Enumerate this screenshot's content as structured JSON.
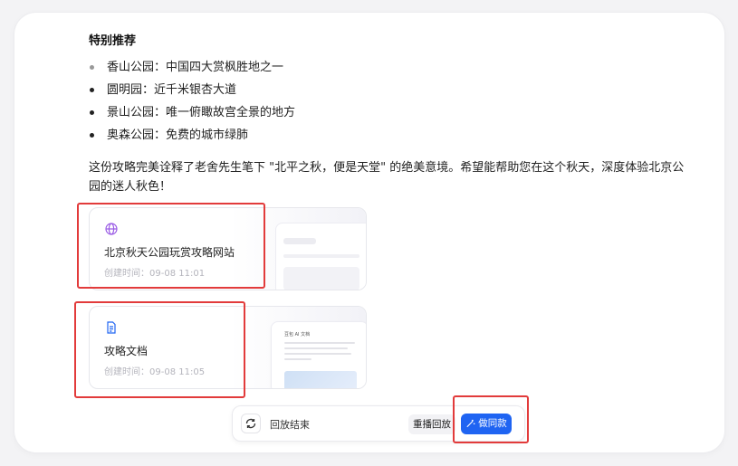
{
  "section": {
    "title": "特别推荐",
    "items": [
      "香山公园：中国四大赏枫胜地之一",
      "圆明园：近千米银杏大道",
      "景山公园：唯一俯瞰故宫全景的地方",
      "奥森公园：免费的城市绿肺"
    ]
  },
  "summary": "这份攻略完美诠释了老舍先生笔下 \"北平之秋，便是天堂\" 的绝美意境。希望能帮助您在这个秋天，深度体验北京公园的迷人秋色！",
  "cards": [
    {
      "name": "北京秋天公园玩赏攻略网站",
      "time": "创建时间：09-08 11:01",
      "icon": "globe-icon"
    },
    {
      "name": "攻略文档",
      "time": "创建时间：09-08 11:05",
      "icon": "document-icon",
      "preview_title": "豆包 AI 文档"
    }
  ],
  "player": {
    "status": "回放结束",
    "replay_label": "重播回放",
    "make_same_label": "做同款"
  },
  "colors": {
    "accent": "#1f64f2",
    "highlight_box": "#e23b3b",
    "globe": "#9b5de5"
  }
}
